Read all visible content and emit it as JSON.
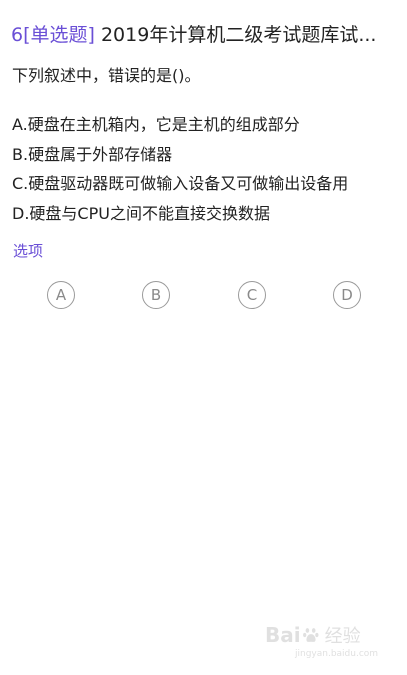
{
  "question": {
    "number": "6",
    "type_label": "[单选题]",
    "title": "2019年计算机二级考试题库试...",
    "stem": "下列叙述中，错误的是()。",
    "options": [
      "A.硬盘在主机箱内，它是主机的组成部分",
      "B.硬盘属于外部存储器",
      "C.硬盘驱动器既可做输入设备又可做输出设备用",
      "D.硬盘与CPU之间不能直接交换数据"
    ]
  },
  "answer": {
    "label": "选项",
    "choices": [
      "A",
      "B",
      "C",
      "D"
    ]
  },
  "watermark": {
    "brand_left": "Bai",
    "brand_right": "经验",
    "url": "jingyan.baidu.com"
  },
  "colors": {
    "accent": "#6a4fd6",
    "text": "#222222",
    "circle_border": "#9a9a9a"
  }
}
